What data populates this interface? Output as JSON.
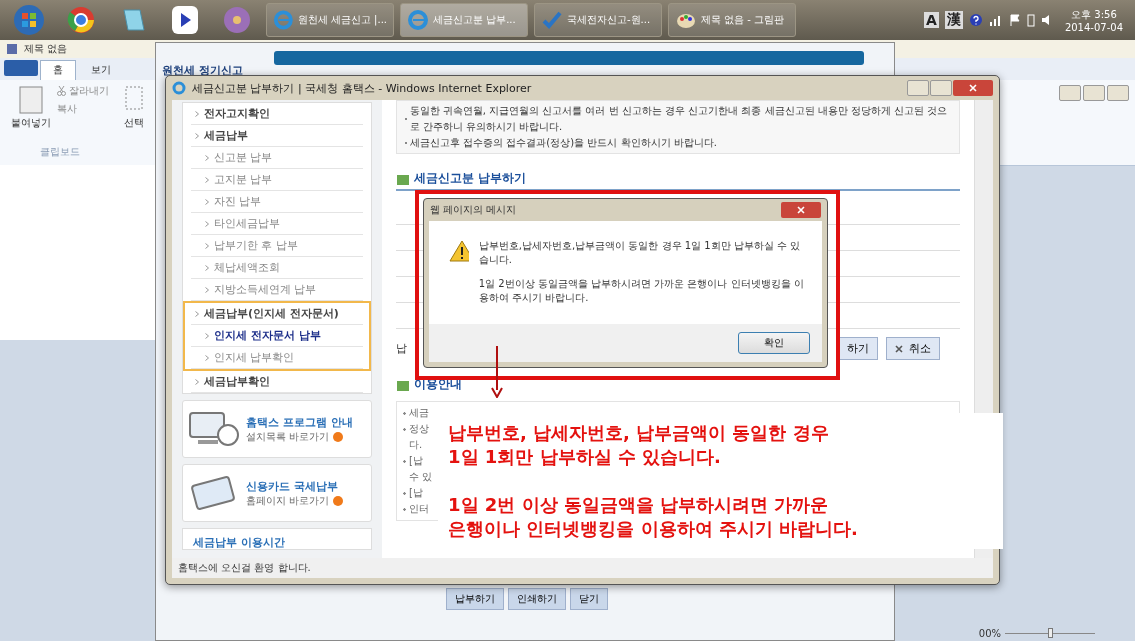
{
  "taskbar": {
    "tasks": [
      {
        "label": "원천세 세금신고 |...",
        "selected": false
      },
      {
        "label": "세금신고분 납부...",
        "selected": true
      },
      {
        "label": "국세전자신고-원...",
        "selected": false
      },
      {
        "label": "제목 없음 - 그림판",
        "selected": false
      }
    ],
    "ime": [
      "A",
      "漢"
    ],
    "time": "오후 3:56",
    "date": "2014-07-04"
  },
  "paint": {
    "title": "제목 없음",
    "tabs": [
      {
        "label": "홈",
        "selected": true
      },
      {
        "label": "보기",
        "selected": false
      }
    ],
    "paste": "붙여넣기",
    "cut": "잘라내기",
    "copy": "복사",
    "select": "선택",
    "group": "클립보드",
    "zoom": "00%",
    "zoom_slider": {
      "level": 0.5
    }
  },
  "back_window": {
    "heading": "원천세 정기신고",
    "buttons": [
      "납부하기",
      "인쇄하기",
      "닫기"
    ]
  },
  "ie_window": {
    "title": "세금신고분 납부하기 | 국세청 홈택스 - Windows Internet Explorer",
    "sidebar": {
      "sections": [
        {
          "label": "전자고지확인",
          "highlighted": false
        },
        {
          "label": "세금납부",
          "highlighted": false,
          "children": [
            {
              "label": "신고분 납부",
              "selected": false
            },
            {
              "label": "고지분 납부",
              "selected": false
            },
            {
              "label": "자진 납부",
              "selected": false
            },
            {
              "label": "타인세금납부",
              "selected": false
            },
            {
              "label": "납부기한 후 납부",
              "selected": false
            },
            {
              "label": "체납세액조회",
              "selected": false
            },
            {
              "label": "지방소득세연계 납부",
              "selected": false
            }
          ]
        },
        {
          "label": "세금납부(인지세 전자문서)",
          "highlighted": true,
          "children": [
            {
              "label": "인지세 전자문서 납부",
              "selected": true
            },
            {
              "label": "인지세 납부확인",
              "selected": false
            }
          ]
        },
        {
          "label": "세금납부확인",
          "highlighted": false
        }
      ]
    },
    "cards": [
      {
        "kind": "program",
        "title": "홈택스 프로그램 안내",
        "link": "설치목록 바로가기"
      },
      {
        "kind": "card",
        "title": "신용카드 국세납부",
        "link": "홈페이지 바로가기"
      }
    ],
    "hours_title": "세금납부 이용시간",
    "notices": [
      "동일한 귀속연월, 지급연월의 신고서를 여러 번 신고하는 경우 신고기한내 최종 세금신고된 내용만 정당하게 신고된 것으로 간주하니 유의하시기 바랍니다.",
      "세금신고후 접수증의 접수결과(정상)을 반드시 확인하시기 바랍니다."
    ],
    "section_title": "세금신고분 납부하기",
    "pay_label": "납",
    "pay_buttons": [
      {
        "kind": "pay",
        "label": "하기"
      },
      {
        "kind": "cancel",
        "label": "취소"
      }
    ],
    "guide_title": "이용안내",
    "guide_lines": [
      {
        "bullet": true,
        "text": "세금"
      },
      {
        "bullet": true,
        "text": "정상"
      },
      {
        "bullet": false,
        "text": "다."
      },
      {
        "bullet": true,
        "text": "[납"
      },
      {
        "bullet": false,
        "text": "수 있"
      },
      {
        "bullet": true,
        "text": "[납"
      },
      {
        "bullet": true,
        "text": "인터"
      }
    ],
    "status": "홈택스에 오신걸 환영 합니다."
  },
  "dialog": {
    "title": "웹 페이지의 메시지",
    "paragraphs": [
      "납부번호,납세자번호,납부금액이 동일한 경우 1일 1회만 납부하실 수 있습니다.",
      "1일 2번이상 동일금액을 납부하시려면 가까운 은행이나 인터넷뱅킹을 이용하여 주시기 바랍니다."
    ],
    "ok": "확인"
  },
  "annotation": {
    "paragraphs": [
      [
        "납부번호, 납세자번호, 납부금액이 동일한 경우",
        "1일 1회만 납부하실 수 있습니다."
      ],
      [
        "1일 2번 이상 동일금액을 납부하시려면 가까운",
        "은행이나 인터넷뱅킹을 이용하여 주시기 바랍니다."
      ]
    ]
  }
}
